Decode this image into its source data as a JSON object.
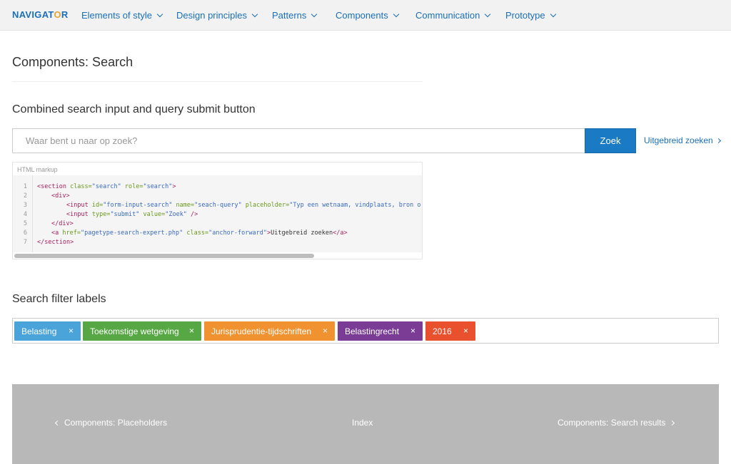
{
  "nav": {
    "logo_main": "NAVIGAT",
    "logo_accent": "O",
    "logo_end": "R",
    "items": [
      {
        "label": "Elements of style"
      },
      {
        "label": "Design principles"
      },
      {
        "label": "Patterns"
      },
      {
        "label": "Components"
      },
      {
        "label": "Communication"
      },
      {
        "label": "Prototype"
      }
    ]
  },
  "page": {
    "title": "Components: Search"
  },
  "search_section": {
    "heading": "Combined search input and query submit button",
    "placeholder": "Waar bent u naar op zoek?",
    "button_label": "Zoek",
    "advanced_link": "Uitgebreid zoeken"
  },
  "code": {
    "label": "HTML markup",
    "line_numbers": [
      "1",
      "2",
      "3",
      "4",
      "5",
      "6",
      "7"
    ],
    "lines": [
      {
        "tag_open": "<section",
        "a1": " class=",
        "v1": "\"search\"",
        "a2": " role=",
        "v2": "\"search\"",
        "tag_close": ">"
      },
      {
        "tag_open": "<div",
        "tag_close": ">"
      },
      {
        "tag_open": "<input",
        "a1": " id=",
        "v1": "\"form-input-search\"",
        "a2": " name=",
        "v2": "\"seach-query\"",
        "a3": " placeholder=",
        "v3": "\"Typ een wetnaam, vindplaats, bron o"
      },
      {
        "tag_open": "<input",
        "a1": " type=",
        "v1": "\"submit\"",
        "a2": " value=",
        "v2": "\"Zoek\"",
        "tag_close": " />"
      },
      {
        "tag_open": "</div",
        "tag_close": ">"
      },
      {
        "tag_open": "<a",
        "a1": " href=",
        "v1": "\"pagetype-search-expert.php\"",
        "a2": " class=",
        "v2": "\"anchor-forward\"",
        "tag_close": ">",
        "text": "Uitgebreid zoeken",
        "tag_end": "</a>"
      },
      {
        "tag_open": "</section",
        "tag_close": ">"
      }
    ]
  },
  "filters_section": {
    "heading": "Search filter labels",
    "close_glyph": "×",
    "chips": [
      {
        "label": "Belasting",
        "color": "#4aa3d9"
      },
      {
        "label": "Toekomstige wetgeving",
        "color": "#57a845"
      },
      {
        "label": "Jurisprudentie-tijdschriften",
        "color": "#f0922f"
      },
      {
        "label": "Belastingrecht",
        "color": "#7b3c96"
      },
      {
        "label": "2016",
        "color": "#e8502e"
      }
    ]
  },
  "footer": {
    "prev": "Components: Placeholders",
    "index": "Index",
    "next": "Components: Search results"
  }
}
